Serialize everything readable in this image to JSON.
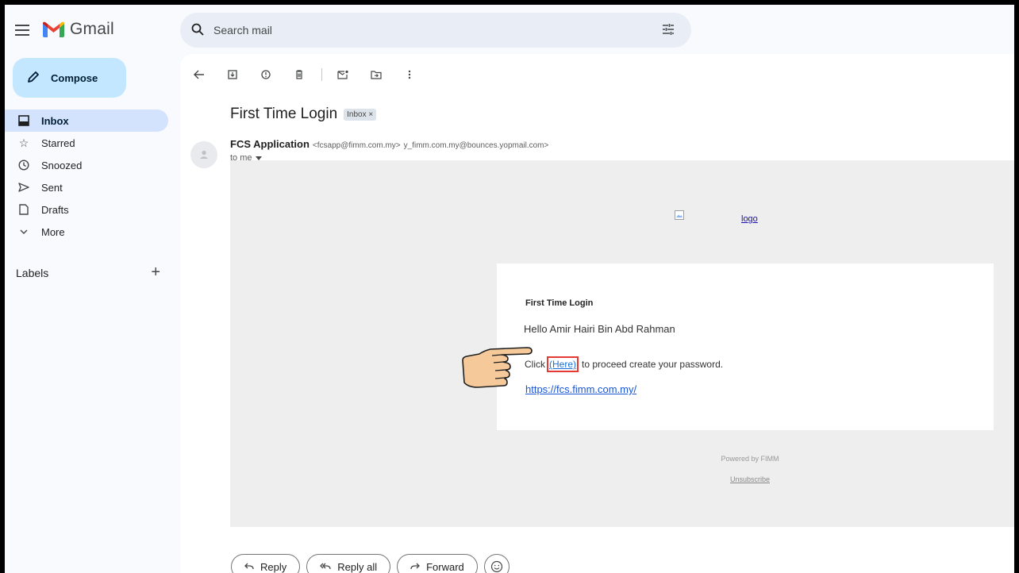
{
  "app": {
    "name": "Gmail"
  },
  "compose": {
    "label": "Compose"
  },
  "nav": {
    "items": [
      {
        "label": "Inbox",
        "icon": "inbox-icon",
        "active": true
      },
      {
        "label": "Starred",
        "icon": "star-icon"
      },
      {
        "label": "Snoozed",
        "icon": "clock-icon"
      },
      {
        "label": "Sent",
        "icon": "send-icon"
      },
      {
        "label": "Drafts",
        "icon": "draft-icon"
      },
      {
        "label": "More",
        "icon": "chevron-down-icon"
      }
    ]
  },
  "labels": {
    "title": "Labels"
  },
  "search": {
    "placeholder": "Search mail"
  },
  "email": {
    "subject": "First Time Login",
    "chip": "Inbox ×",
    "sender_name": "FCS Application",
    "sender_email": "<fcsapp@fimm.com.my>",
    "via": "y_fimm.com.my@bounces.yopmail.com>",
    "to": "to me",
    "logo_alt": "logo",
    "heading": "First Time Login",
    "greeting": "Hello Amir Hairi Bin Abd Rahman",
    "click_prefix": "Click",
    "here": "(Here)",
    "click_suffix": "to proceed create your password.",
    "url": "https://fcs.fimm.com.my/",
    "powered": "Powered by FIMM",
    "unsubscribe": "Unsubscribe"
  },
  "actions": {
    "reply": "Reply",
    "reply_all": "Reply all",
    "forward": "Forward"
  },
  "colors": {
    "compose_bg": "#c2e7ff",
    "active_nav": "#d3e3fd",
    "highlight_box": "#e53935"
  }
}
